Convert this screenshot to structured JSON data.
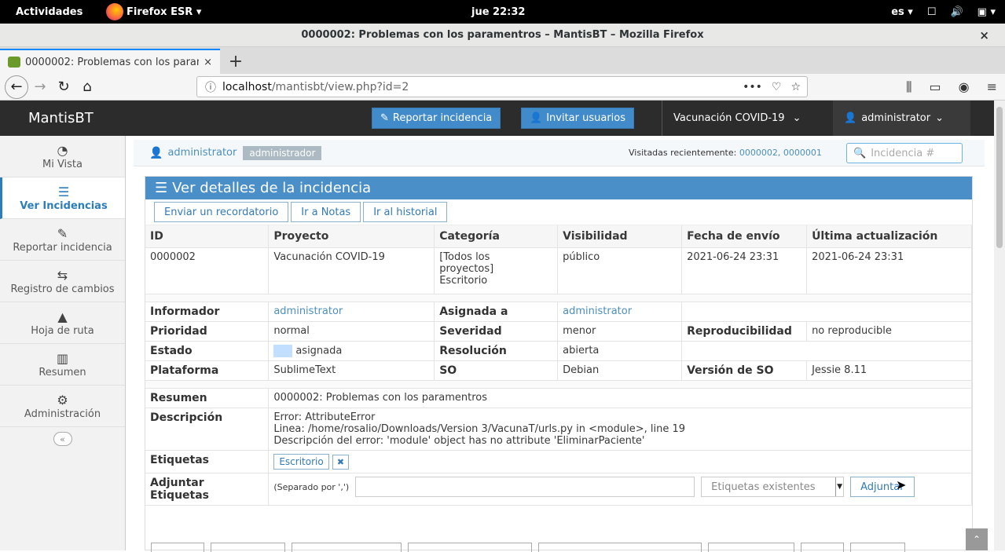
{
  "os": {
    "activities": "Actividades",
    "app_menu": "Firefox ESR ▾",
    "clock": "jue 22:32",
    "lang": "es ▾"
  },
  "window": {
    "title": "0000002: Problemas con los paramentros – MantisBT – Mozilla Firefox",
    "close": "×"
  },
  "tab": {
    "title": "0000002: Problemas con los paramentros",
    "close": "×",
    "new": "+"
  },
  "url": {
    "host": "localhost",
    "path": "/mantisbt/view.php?id=2"
  },
  "mantis": {
    "brand": "MantisBT",
    "report_btn": "Reportar incidencia",
    "invite_btn": "Invitar usuarios",
    "project": "Vacunación COVID-19",
    "user": "administrator"
  },
  "sidebar": {
    "items": [
      {
        "label": "Mi Vista",
        "icon": "tachometer-icon"
      },
      {
        "label": "Ver Incidencias",
        "icon": "list-icon"
      },
      {
        "label": "Reportar incidencia",
        "icon": "edit-icon"
      },
      {
        "label": "Registro de cambios",
        "icon": "retweet-icon"
      },
      {
        "label": "Hoja de ruta",
        "icon": "road-icon"
      },
      {
        "label": "Resumen",
        "icon": "bar-chart-icon"
      },
      {
        "label": "Administración",
        "icon": "gears-icon"
      }
    ],
    "collapse": "«"
  },
  "breadcrumb": {
    "user": "administrator",
    "role": "administrador",
    "recent_label": "Visitadas recientemente: ",
    "recent_links": "0000002, 0000001",
    "search_placeholder": "Incidencia #"
  },
  "details": {
    "header": "Ver detalles de la incidencia",
    "buttons": [
      "Enviar un recordatorio",
      "Ir a Notas",
      "Ir al historial"
    ],
    "columns": [
      "ID",
      "Proyecto",
      "Categoría",
      "Visibilidad",
      "Fecha de envío",
      "Última actualización"
    ],
    "row": {
      "id": "0000002",
      "project": "Vacunación COVID-19",
      "category_1": "[Todos los",
      "category_2": "proyectos]",
      "category_3": "Escritorio",
      "visibility": "público",
      "submitted": "2021-06-24 23:31",
      "updated": "2021-06-24 23:31"
    },
    "labels": {
      "reporter": "Informador",
      "assigned": "Asignada a",
      "priority": "Prioridad",
      "severity": "Severidad",
      "reproducibility": "Reproducibilidad",
      "status": "Estado",
      "resolution": "Resolución",
      "platform": "Plataforma",
      "os": "SO",
      "os_version": "Versión de SO",
      "summary": "Resumen",
      "description": "Descripción",
      "tags": "Etiquetas",
      "attach_tags_1": "Adjuntar",
      "attach_tags_2": "Etiquetas"
    },
    "values": {
      "reporter": "administrator",
      "assigned": "administrator",
      "priority": "normal",
      "severity": "menor",
      "reproducibility": "no reproducible",
      "status": "asignada",
      "resolution": "abierta",
      "platform": "SublimeText",
      "os": "Debian",
      "os_version": "Jessie 8.11",
      "summary": "0000002: Problemas con los paramentros",
      "desc_1": "Error: AttributeError",
      "desc_2": "Linea: /home/rosalio/Downloads/Version 3/VacunaT/urls.py in <module>, line 19",
      "desc_3": "Descripción del error: 'module' object has no attribute 'EliminarPaciente'",
      "tag": "Escritorio",
      "tag_remove": "✖",
      "separator_hint": "(Separado por ',')",
      "existing_tags": "Etiquetas existentes",
      "attach_btn": "Adjuntar"
    }
  }
}
